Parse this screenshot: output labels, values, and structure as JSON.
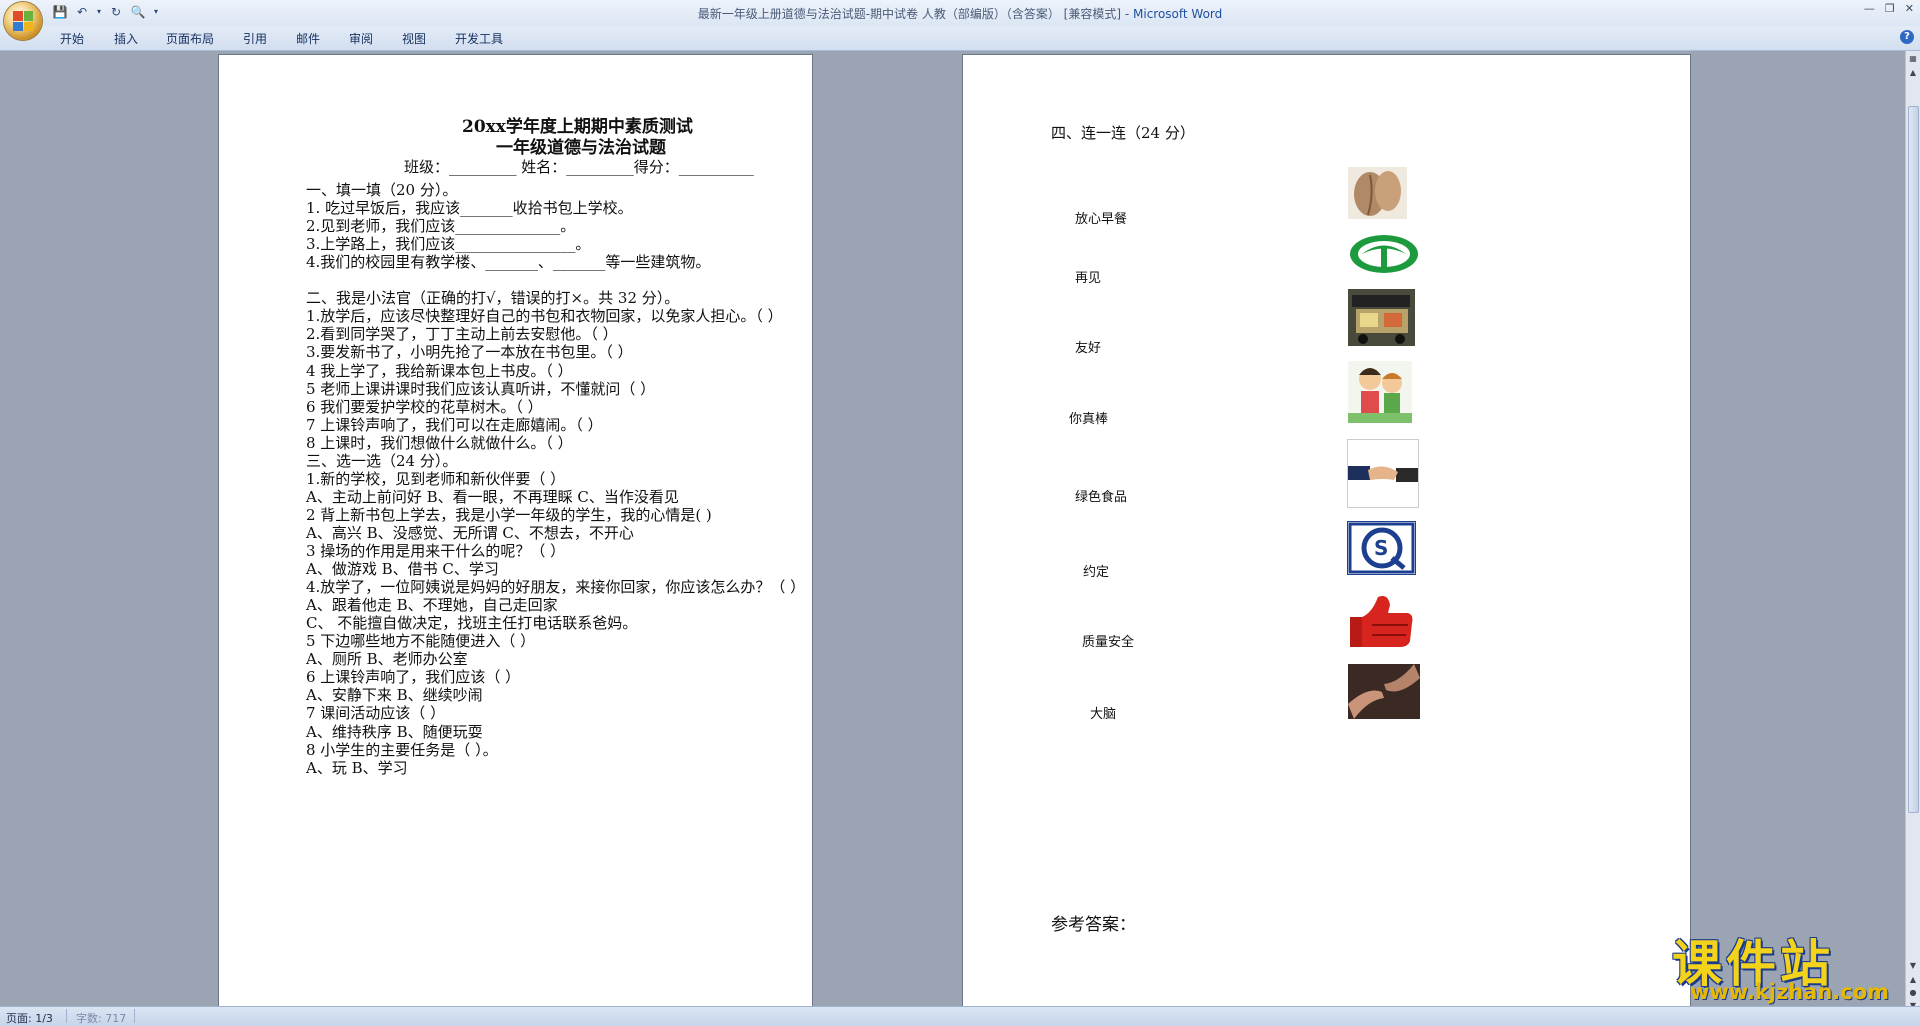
{
  "window": {
    "title_prefix": "最新一年级上册道德与法治试题-期中试卷 人教（部编版）（含答案） [兼容模式] - ",
    "app_name": "Microsoft Word"
  },
  "ribbon": {
    "tabs": [
      "开始",
      "插入",
      "页面布局",
      "引用",
      "邮件",
      "审阅",
      "视图",
      "开发工具"
    ]
  },
  "page1": {
    "title1": "20xx学年度上期期中素质测试",
    "title2": "一年级道德与法治试题",
    "info": "班级：_________ 姓名：_________得分：__________",
    "lines": [
      "一、填一填（20 分）。",
      "1. 吃过早饭后，我应该_______收拾书包上学校。",
      "2.见到老师，我们应该______________。",
      "3.上学路上，我们应该________________。",
      "4.我们的校园里有教学楼、_______、_______等一些建筑物。",
      "",
      "二、我是小法官（正确的打√，错误的打×。共 32 分）。",
      "1.放学后，应该尽快整理好自己的书包和衣物回家，以免家人担心。（    ）",
      "2.看到同学哭了，丁丁主动上前去安慰他。（    ）",
      "3.要发新书了，小明先抢了一本放在书包里。（    ）",
      "4 我上学了，我给新课本包上书皮。（    ）",
      "5 老师上课讲课时我们应该认真听讲，不懂就问（    ）",
      "6 我们要爱护学校的花草树木。（    ）",
      "7 上课铃声响了，我们可以在走廊嬉闹。（    ）",
      "8 上课时，我们想做什么就做什么。（    ）",
      "三、选一选（24 分）。",
      "1.新的学校，见到老师和新伙伴要（    ）",
      "  A、主动上前问好      B、看一眼，不再理睬       C、当作没看见",
      "2 背上新书包上学去，我是小学一年级的学生，我的心情是(    )",
      "  A、高兴        B、没感觉、无所谓        C、不想去，不开心",
      "3 操场的作用是用来干什么的呢？（    ）",
      "A、做游戏        B、借书        C、学习",
      "4.放学了，一位阿姨说是妈妈的好朋友，来接你回家，你应该怎么办？（    ）",
      "A、跟着他走          B、不理她，自己走回家",
      "C、    不能擅自做决定，找班主任打电话联系爸妈。",
      "5 下边哪些地方不能随便进入（    ）",
      "A、厕所       B、老师办公室",
      "6 上课铃声响了，我们应该（    ）",
      "  A、安静下来         B、继续吵闹",
      "7 课间活动应该（    ）",
      "  A、维持秩序          B、随便玩耍",
      "8 小学生的主要任务是（    ）。",
      "  A、玩          B、学习"
    ]
  },
  "page2": {
    "heading": "四、连一连（24 分）",
    "labels": [
      "放心早餐",
      "再见",
      "友好",
      "你真棒",
      "绿色食品",
      "约定",
      "质量安全",
      "大脑"
    ],
    "images": [
      "walnut-image",
      "green-food-logo",
      "breakfast-cart-image",
      "children-image",
      "handshake-image",
      "qs-logo",
      "thumbs-up-image",
      "pinky-promise-image"
    ],
    "answer_heading": "参考答案："
  },
  "status": {
    "page": "页面: 1/3",
    "words": "字数: 717"
  },
  "watermark": {
    "big": "课件站",
    "small": "www.kjzhan.com"
  },
  "colors": {
    "workspace": "#9aa4b3",
    "ribbon": "#dbe6f4",
    "watermark_yellow": "#f3d21b",
    "watermark_blue": "#1a3a8a"
  }
}
